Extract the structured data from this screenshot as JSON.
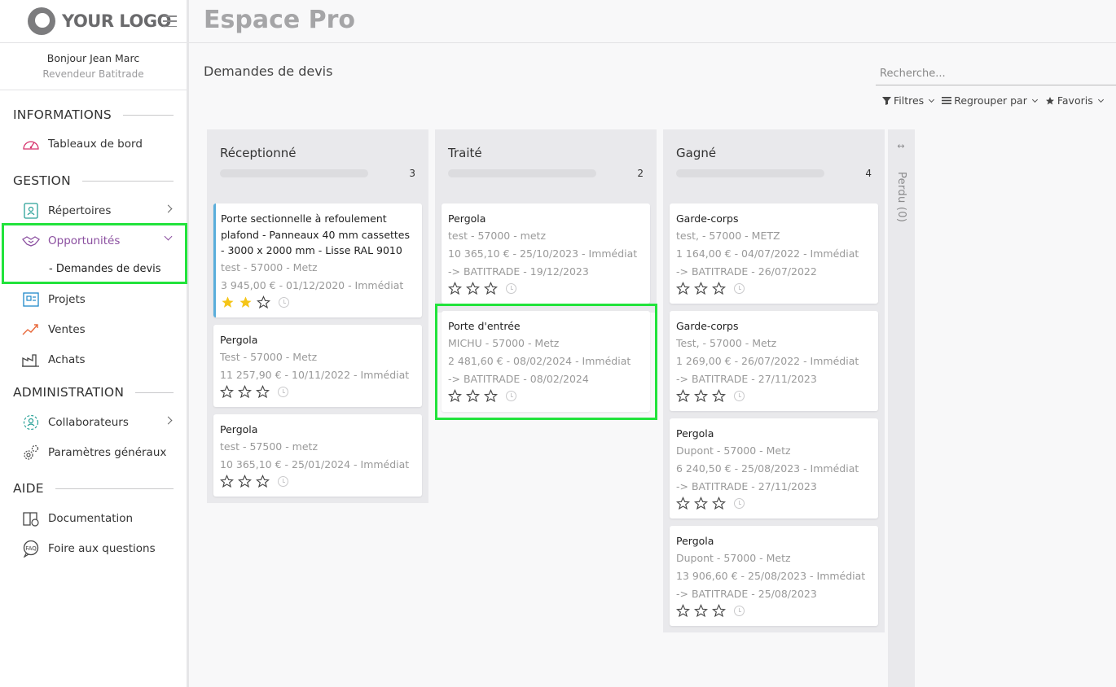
{
  "sidebar": {
    "logo": "YOUR LOGO",
    "user_greeting": "Bonjour Jean Marc",
    "user_role": "Revendeur Batitrade",
    "sections": {
      "informations": "INFORMATIONS",
      "gestion": "GESTION",
      "administration": "ADMINISTRATION",
      "aide": "AIDE"
    },
    "items": {
      "tableaux": "Tableaux de bord",
      "repertoires": "Répertoires",
      "opportunites": "Opportunités",
      "demandes": "- Demandes de devis",
      "projets": "Projets",
      "ventes": "Ventes",
      "achats": "Achats",
      "collaborateurs": "Collaborateurs",
      "parametres": "Paramètres généraux",
      "documentation": "Documentation",
      "faq": "Foire aux questions"
    },
    "active_color": "#8b4fa0"
  },
  "header": {
    "title": "Espace Pro"
  },
  "subheader": {
    "title": "Demandes de devis",
    "search_placeholder": "Recherche...",
    "filters": "Filtres",
    "group_by": "Regrouper par",
    "favorites": "Favoris"
  },
  "columns": [
    {
      "title": "Réceptionné",
      "count": "3",
      "cards": [
        {
          "title": "Porte sectionnelle à refoulement plafond - Panneaux 40 mm cassettes - 3000 x 2000 mm - Lisse RAL 9010",
          "line1": "test - 57000 - Metz",
          "line2": "3 945,00 € - 01/12/2020 - Immédiat",
          "stars": 2
        },
        {
          "title": "Pergola",
          "line1": "Test - 57000 - Metz",
          "line2": "11 257,90 € - 10/11/2022 - Immédiat",
          "stars": 0
        },
        {
          "title": "Pergola",
          "line1": "test - 57500 - metz",
          "line2": "10 365,10 € - 25/01/2024 - Immédiat",
          "stars": 0
        }
      ]
    },
    {
      "title": "Traité",
      "count": "2",
      "cards": [
        {
          "title": "Pergola",
          "line1": "test - 57000 - metz",
          "line2": "10 365,10 € - 25/10/2023 - Immédiat",
          "line3": "-> BATITRADE - 19/12/2023",
          "stars": 0
        },
        {
          "title": "Porte d'entrée",
          "line1": "MICHU - 57000 - Metz",
          "line2": "2 481,60 € - 08/02/2024 - Immédiat",
          "line3": "-> BATITRADE - 08/02/2024",
          "stars": 0
        }
      ]
    },
    {
      "title": "Gagné",
      "count": "4",
      "cards": [
        {
          "title": "Garde-corps",
          "line1": "test, - 57000 - METZ",
          "line2": "1 164,00 € - 04/07/2022 - Immédiat",
          "line3": "-> BATITRADE - 26/07/2022",
          "stars": 0
        },
        {
          "title": "Garde-corps",
          "line1": "Test, - 57000 - Metz",
          "line2": "1 269,00 € - 26/07/2022 - Immédiat",
          "line3": "-> BATITRADE - 27/11/2023",
          "stars": 0
        },
        {
          "title": "Pergola",
          "line1": "Dupont - 57000 - Metz",
          "line2": "6 240,50 € - 25/08/2023 - Immédiat",
          "line3": "-> BATITRADE - 27/11/2023",
          "stars": 0
        },
        {
          "title": "Pergola",
          "line1": "Dupont - 57000 - Metz",
          "line2": "13 906,60 € - 25/08/2023 - Immédiat",
          "line3": "-> BATITRADE - 25/08/2023",
          "stars": 0
        }
      ]
    }
  ],
  "folded_column": {
    "label": "Perdu (0)"
  },
  "colors": {
    "star_filled": "#f5c518",
    "card_accent": "#5aaedb",
    "highlight": "#22e33c"
  }
}
